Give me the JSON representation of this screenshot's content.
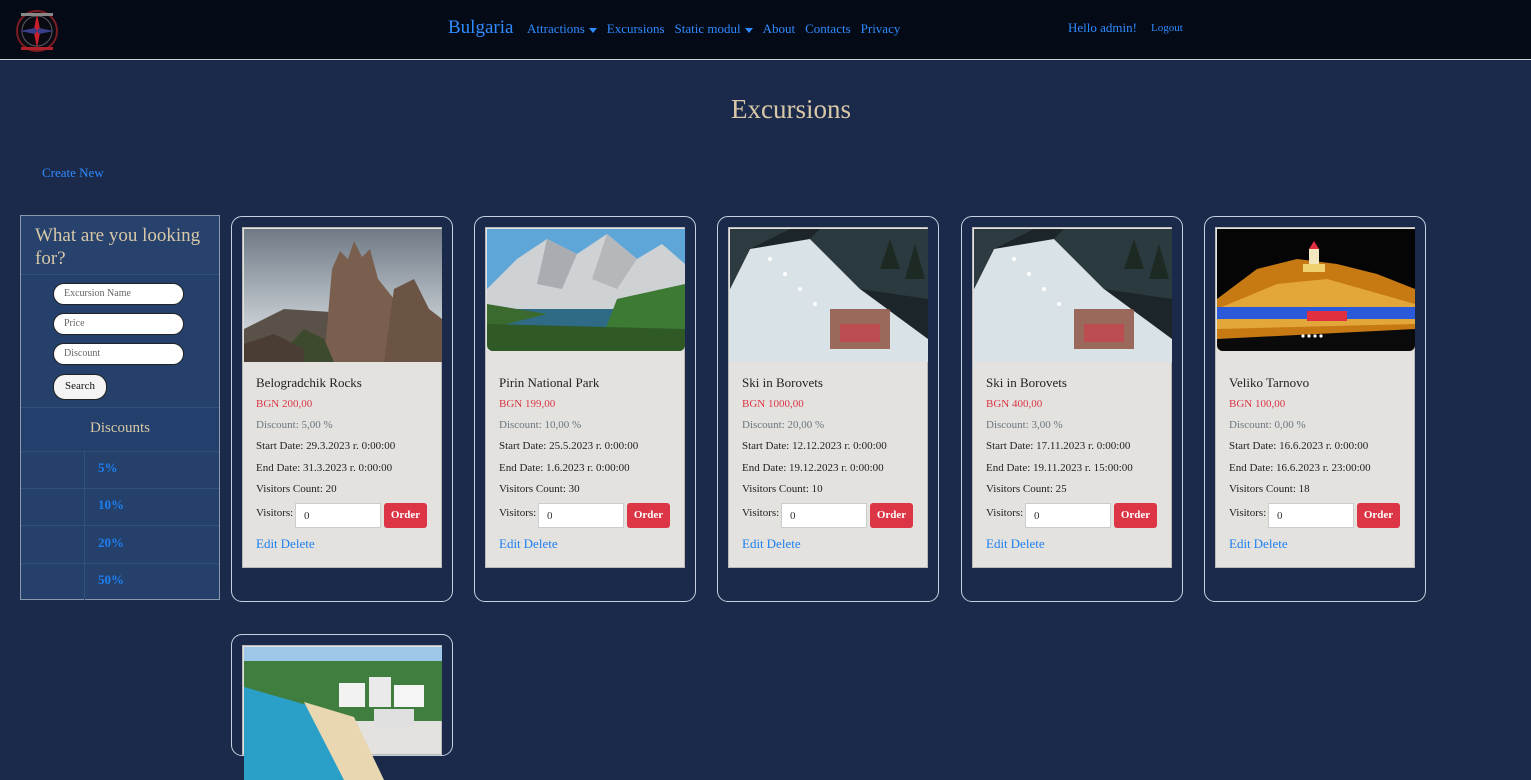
{
  "nav": {
    "brand": "Bulgaria",
    "items": [
      {
        "label": "Attractions",
        "dropdown": true
      },
      {
        "label": "Excursions",
        "dropdown": false
      },
      {
        "label": "Static modul",
        "dropdown": true
      },
      {
        "label": "About",
        "dropdown": false
      },
      {
        "label": "Contacts",
        "dropdown": false
      },
      {
        "label": "Privacy",
        "dropdown": false
      }
    ],
    "greeting": "Hello admin!",
    "logout": "Logout"
  },
  "page": {
    "title": "Excursions",
    "create_new": "Create New"
  },
  "sidebar": {
    "title": "What are you looking for?",
    "inputs": {
      "name_placeholder": "Excursion Name",
      "price_placeholder": "Price",
      "discount_placeholder": "Discount"
    },
    "search_label": "Search",
    "discounts_heading": "Discounts",
    "discounts": [
      "5%",
      "10%",
      "20%",
      "50%"
    ]
  },
  "labels": {
    "visitors": "Visitors:",
    "order": "Order",
    "edit": "Edit",
    "delete": "Delete"
  },
  "cards": [
    {
      "name": "Belogradchik Rocks",
      "price": "BGN 200,00",
      "discount": "Discount: 5,00 %",
      "start": "Start Date: 29.3.2023 г. 0:00:00",
      "end": "End Date: 31.3.2023 г. 0:00:00",
      "visitors_count": "Visitors Count: 20",
      "visitors_value": "0",
      "image": "rocks"
    },
    {
      "name": "Pirin National Park",
      "price": "BGN 199,00",
      "discount": "Discount: 10,00 %",
      "start": "Start Date: 25.5.2023 г. 0:00:00",
      "end": "End Date: 1.6.2023 г. 0:00:00",
      "visitors_count": "Visitors Count: 30",
      "visitors_value": "0",
      "image": "mountain-lake"
    },
    {
      "name": "Ski in Borovets",
      "price": "BGN 1000,00",
      "discount": "Discount: 20,00 %",
      "start": "Start Date: 12.12.2023 г. 0:00:00",
      "end": "End Date: 19.12.2023 г. 0:00:00",
      "visitors_count": "Visitors Count: 10",
      "visitors_value": "0",
      "image": "ski-night"
    },
    {
      "name": "Ski in Borovets",
      "price": "BGN 400,00",
      "discount": "Discount: 3,00 %",
      "start": "Start Date: 17.11.2023 г. 0:00:00",
      "end": "End Date: 19.11.2023 г. 15:00:00",
      "visitors_count": "Visitors Count: 25",
      "visitors_value": "0",
      "image": "ski-night"
    },
    {
      "name": "Veliko Tarnovo",
      "price": "BGN 100,00",
      "discount": "Discount: 0,00 %",
      "start": "Start Date: 16.6.2023 г. 0:00:00",
      "end": "End Date: 16.6.2023 г. 23:00:00",
      "visitors_count": "Visitors Count: 18",
      "visitors_value": "0",
      "image": "fortress-lights"
    }
  ],
  "colors": {
    "accent": "#2f8bff",
    "order": "#dc3545",
    "background": "#1b2a4b"
  }
}
